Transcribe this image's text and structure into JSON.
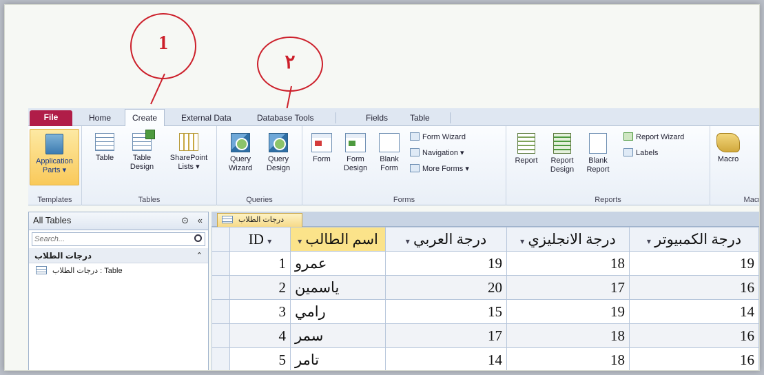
{
  "annotations": {
    "callout_1": "1",
    "callout_2": "٢"
  },
  "tabs": [
    "File",
    "Home",
    "Create",
    "External Data",
    "Database Tools",
    "Fields",
    "Table"
  ],
  "active_tab": "Create",
  "ribbon": {
    "templates": {
      "label": "Templates",
      "app_parts": "Application Parts ▾"
    },
    "tables": {
      "label": "Tables",
      "table": "Table",
      "table_design": "Table Design",
      "sharepoint": "SharePoint Lists ▾"
    },
    "queries": {
      "label": "Queries",
      "query_wizard": "Query Wizard",
      "query_design": "Query Design"
    },
    "forms": {
      "label": "Forms",
      "form": "Form",
      "form_design": "Form Design",
      "blank_form": "Blank Form",
      "form_wizard": "Form Wizard",
      "navigation": "Navigation ▾",
      "more_forms": "More Forms ▾"
    },
    "reports": {
      "label": "Reports",
      "report": "Report",
      "report_design": "Report Design",
      "blank_report": "Blank Report",
      "report_wizard": "Report Wizard",
      "labels": "Labels"
    },
    "macro": {
      "label": "Macr",
      "macro": "Macro"
    }
  },
  "nav": {
    "title": "All Tables",
    "search_placeholder": "Search...",
    "group": "درجات الطلاب",
    "item": "درجات الطلاب : Table"
  },
  "document_tab": "درجات الطلاب",
  "datasheet": {
    "columns": [
      "ID",
      "اسم الطالب",
      "درجة العربي",
      "درجة الانجليزي",
      "درجة الكمبيوتر"
    ],
    "rows": [
      {
        "id": "1",
        "name": "عمرو",
        "arabic": "19",
        "english": "18",
        "computer": "19"
      },
      {
        "id": "2",
        "name": "ياسمين",
        "arabic": "20",
        "english": "17",
        "computer": "16"
      },
      {
        "id": "3",
        "name": "رامي",
        "arabic": "15",
        "english": "19",
        "computer": "14"
      },
      {
        "id": "4",
        "name": "سمر",
        "arabic": "17",
        "english": "18",
        "computer": "16"
      },
      {
        "id": "5",
        "name": "تامر",
        "arabic": "14",
        "english": "18",
        "computer": "16"
      }
    ]
  },
  "colors": {
    "file_tab": "#b01d48",
    "annotation": "#cc1f2a",
    "highlight": "#fbe38a"
  }
}
